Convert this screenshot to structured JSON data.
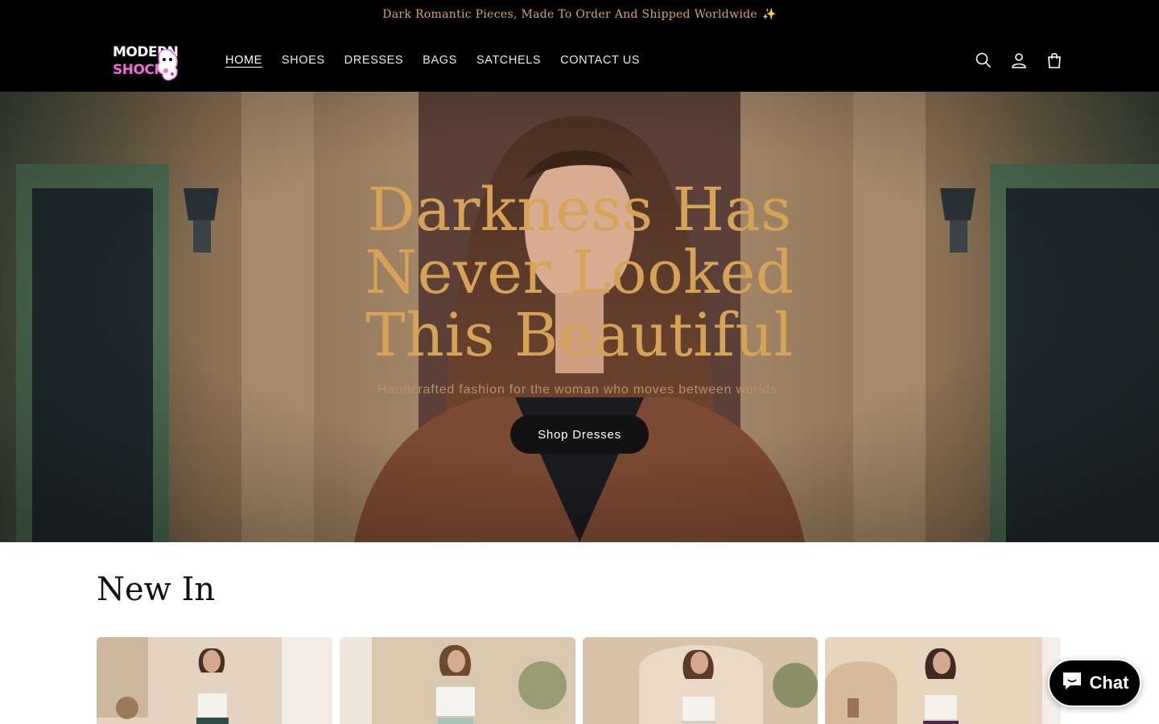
{
  "announcement": {
    "text": "Dark Romantic Pieces, Made To Order And Shipped Worldwide",
    "emoji": "✨"
  },
  "header": {
    "logo_text_line1": "MODERN",
    "logo_text_line2": "SHOCK",
    "nav": [
      {
        "label": "HOME",
        "active": true
      },
      {
        "label": "SHOES"
      },
      {
        "label": "DRESSES"
      },
      {
        "label": "BAGS"
      },
      {
        "label": "SATCHELS"
      },
      {
        "label": "CONTACT US"
      }
    ],
    "icons": [
      "search-icon",
      "account-icon",
      "cart-icon"
    ]
  },
  "hero": {
    "title": "Darkness Has Never Looked This Beautiful",
    "subtitle": "Handcrafted fashion for the woman who moves between worlds.",
    "button_label": "Shop Dresses"
  },
  "section": {
    "title": "New In"
  },
  "chat": {
    "label": "Chat"
  },
  "colors": {
    "accent_gold": "#d4a358",
    "header_bg": "#000000",
    "button_bg": "#121212"
  }
}
